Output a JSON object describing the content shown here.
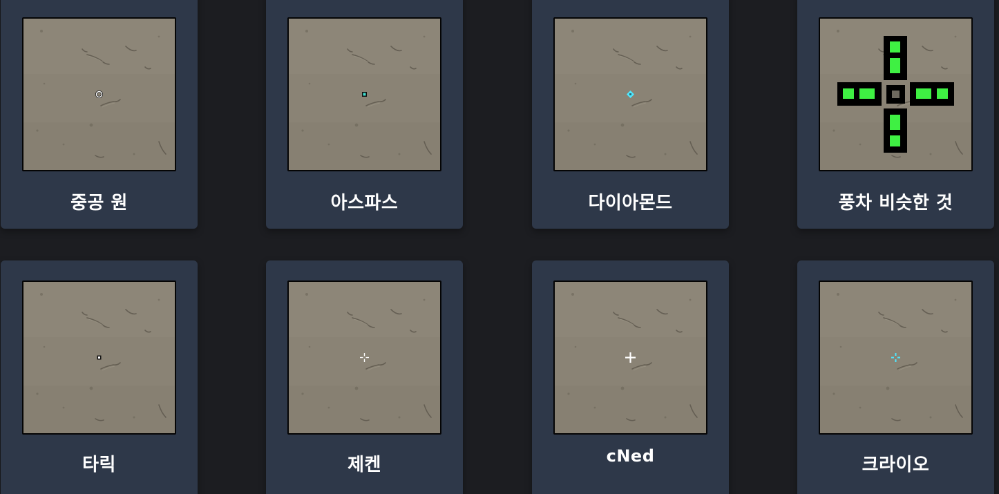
{
  "crosshairs": [
    {
      "label": "중공 원",
      "style": "hollow-circle",
      "color": "#ffffff"
    },
    {
      "label": "아스파스",
      "style": "outlined-square-dot",
      "color": "#3fe0d0"
    },
    {
      "label": "다이아몬드",
      "style": "diamond",
      "color": "#4fe8ff"
    },
    {
      "label": "풍차 비슷한 것",
      "style": "outlined-cross",
      "color": "#3ff043"
    },
    {
      "label": "타릭",
      "style": "small-dot",
      "color": "#ffffff"
    },
    {
      "label": "제켄",
      "style": "gap-cross",
      "color": "#ffffff"
    },
    {
      "label": "cNed",
      "style": "plus",
      "color": "#ffffff"
    },
    {
      "label": "크라이오",
      "style": "gap-cross-cyan",
      "color": "#4fe8ff"
    }
  ]
}
